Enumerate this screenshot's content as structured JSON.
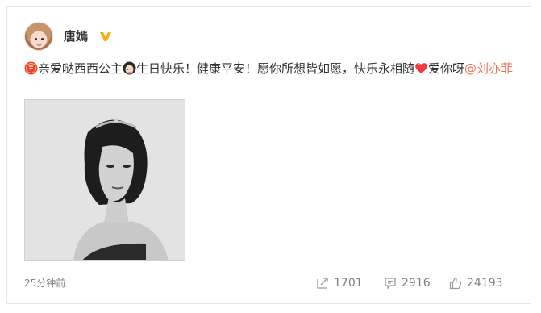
{
  "post": {
    "author": "唐嫣",
    "text_part1": "亲爱哒西西公主",
    "text_part2": "生日快乐！健康平安！愿你所想皆如愿，快乐永相随",
    "text_part3": "爱你呀",
    "mention": "@刘亦菲",
    "timestamp": "25分钟前"
  },
  "icons": {
    "verified": "verified-v-icon",
    "celebrate": "celebrate-emoji-icon",
    "girl": "girl-face-emoji-icon",
    "heart": "red-heart-emoji-icon",
    "forward": "forward-icon",
    "comment": "comment-icon",
    "like": "thumbs-up-icon"
  },
  "actions": {
    "forward_count": "1701",
    "comment_count": "2916",
    "like_count": "24193"
  },
  "colors": {
    "mention": "#eb7350",
    "verified": "#f7a815",
    "text": "#333333",
    "muted": "#808080"
  }
}
